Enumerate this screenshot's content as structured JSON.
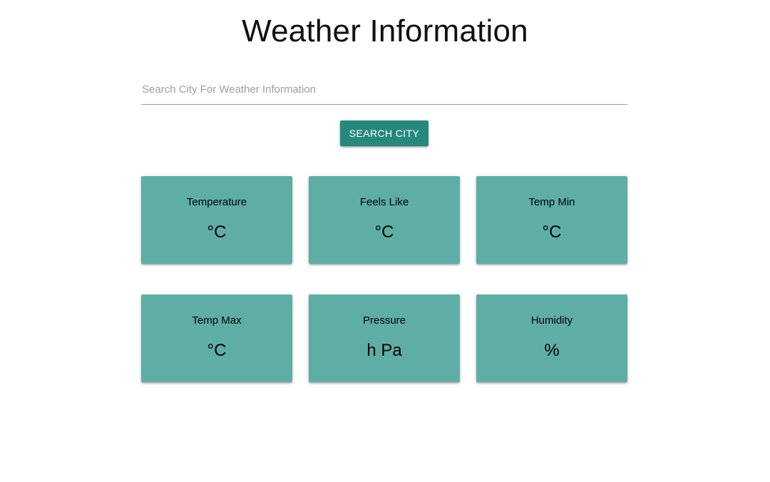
{
  "header": {
    "title": "Weather Information"
  },
  "search": {
    "placeholder": "Search City For Weather Information",
    "value": "",
    "button_label": "SEARCH CITY"
  },
  "cards": [
    {
      "label": "Temperature",
      "value": "°C"
    },
    {
      "label": "Feels Like",
      "value": "°C"
    },
    {
      "label": "Temp Min",
      "value": "°C"
    },
    {
      "label": "Temp Max",
      "value": "°C"
    },
    {
      "label": "Pressure",
      "value": "h Pa"
    },
    {
      "label": "Humidity",
      "value": "%"
    }
  ],
  "colors": {
    "button": "#26897c",
    "card": "#5faea6",
    "underline": "#9e9e9e"
  }
}
